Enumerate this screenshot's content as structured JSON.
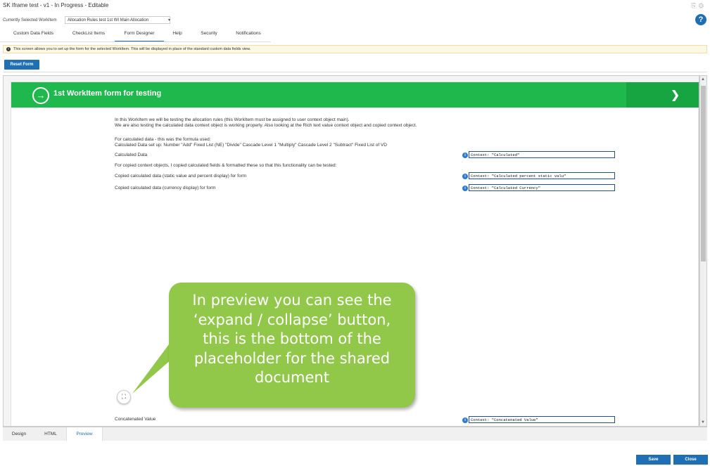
{
  "window": {
    "title": "SK Iframe test - v1 - In Progress - Editable",
    "icons": [
      "print-icon",
      "gear-icon"
    ],
    "help_glyph": "?"
  },
  "workitem": {
    "label": "Currently Selected WorkItem",
    "selected": "Allocation Rules test 1st WI Main Allocation",
    "caret": "▾"
  },
  "tabs": [
    {
      "label": "Custom Data Fields",
      "active": false
    },
    {
      "label": "CheckList Items",
      "active": false
    },
    {
      "label": "Form Designer",
      "active": true
    },
    {
      "label": "Help",
      "active": false
    },
    {
      "label": "Security",
      "active": false
    },
    {
      "label": "Notifications",
      "active": false
    }
  ],
  "info": {
    "glyph": "!",
    "text": "This screen allows you to set up the form for the selected WorkItem. This will be displayed in place of the standard custom data fields view."
  },
  "toolbar": {
    "reset_label": "Reset Form"
  },
  "form": {
    "title": "1st WorkItem form for testing",
    "intro_line1": "In this WorkItem we will be testing the allocation rules (this WorkItem must be assigned to user context object main).",
    "intro_line2": "We are also testing the calculated data context object is working properly. Also looking at the Rich text value context object and copied context object.",
    "formula_line1": "For calculated data - this was the formula used:",
    "formula_line2": "Calculated Data set up: Number \"Add\" Fixed List (NE) \"Divide\" Cascade Level 1 \"Multiply\" Cascade Level 2 \"Subtract\" Fixed List of VD",
    "copied_note": "For copied context objects, I copied calculated fields & formatted these so that this functionality can be tested:",
    "fields": [
      {
        "label": "Calculated Data",
        "context": "Context: \"Calculated\""
      },
      {
        "label": "Copied calculated data (static value and percent display) for form",
        "context": "Context: \"Calculated percent static valu\""
      },
      {
        "label": "Copied calculated data (currency display) for form",
        "context": "Context: \"Calculated Currency\""
      },
      {
        "label": "Concatenated Value",
        "context": "Context: \"Concatenated Value\""
      }
    ],
    "info_glyph": "i"
  },
  "callout": {
    "text": "In preview you can see the\n‘expand / collapse’ button,\nthis is the bottom of the\nplaceholder for the shared\ndocument"
  },
  "expand_glyph": "⛶",
  "bottom_tabs": [
    {
      "label": "Design",
      "active": false
    },
    {
      "label": "HTML",
      "active": false
    },
    {
      "label": "Preview",
      "active": true
    }
  ],
  "footer": {
    "save_label": "Save",
    "close_label": "Close"
  },
  "colors": {
    "accent": "#1f6fb5",
    "header_green": "#1eb84c",
    "callout_green": "#92c84a"
  }
}
